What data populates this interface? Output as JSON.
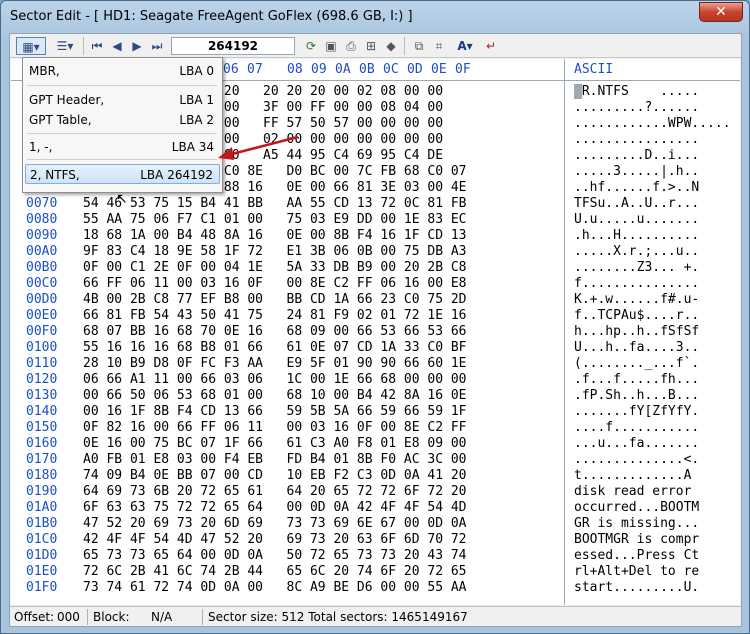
{
  "window": {
    "title": "Sector Edit - [ HD1: Seagate FreeAgent GoFlex (698.6 GB, I:) ]",
    "close_label": "✕"
  },
  "toolbar": {
    "sector_value": "264192"
  },
  "header": {
    "columns": [
      "05",
      "06",
      "07",
      "08",
      "09",
      "0A",
      "0B",
      "0C",
      "0D",
      "0E",
      "0F"
    ],
    "ascii": "ASCII"
  },
  "rows": [
    {
      "off": "",
      "hex": "            46 53 20   20 20 20 00 02 08 00 00",
      "ascii": "R.NTFS    ....."
    },
    {
      "off": "",
      "hex": "            F8 00 00   3F 00 FF 00 00 08 04 00",
      "ascii": ".........?......"
    },
    {
      "off": "",
      "hex": "            00 80 00   FF 57 50 57 00 00 00 00",
      "ascii": "............WPW....."
    },
    {
      "off": "",
      "hex": "            00 00 00   02 00 00 00 00 00 00 00",
      "ascii": "................"
    },
    {
      "off": "",
      "hex": "            00 00 00   A5 44 95 C4 69 95 C4 DE",
      "ascii": ".........D..i..."
    },
    {
      "off": "",
      "hex": "            FA 33 C0 8E   D0 BC 00 7C FB 68 C0 07",
      "ascii": ".....3.....|.h.."
    },
    {
      "off": "0060",
      "hex": "1F 1E 68 66 00 CB 88 16   0E 00 66 81 3E 03 00 4E",
      "ascii": "..hf......f.>..N"
    },
    {
      "off": "0070",
      "hex": "54 46 53 75 15 B4 41 BB   AA 55 CD 13 72 0C 81 FB",
      "ascii": "TFSu..A..U..r..."
    },
    {
      "off": "0080",
      "hex": "55 AA 75 06 F7 C1 01 00   75 03 E9 DD 00 1E 83 EC",
      "ascii": "U.u.....u......."
    },
    {
      "off": "0090",
      "hex": "18 68 1A 00 B4 48 8A 16   0E 00 8B F4 16 1F CD 13",
      "ascii": ".h...H.........."
    },
    {
      "off": "00A0",
      "hex": "9F 83 C4 18 9E 58 1F 72   E1 3B 06 0B 00 75 DB A3",
      "ascii": ".....X.r.;...u.."
    },
    {
      "off": "00B0",
      "hex": "0F 00 C1 2E 0F 00 04 1E   5A 33 DB B9 00 20 2B C8",
      "ascii": "........Z3... +."
    },
    {
      "off": "00C0",
      "hex": "66 FF 06 11 00 03 16 0F   00 8E C2 FF 06 16 00 E8",
      "ascii": "f..............."
    },
    {
      "off": "00D0",
      "hex": "4B 00 2B C8 77 EF B8 00   BB CD 1A 66 23 C0 75 2D",
      "ascii": "K.+.w......f#.u-"
    },
    {
      "off": "00E0",
      "hex": "66 81 FB 54 43 50 41 75   24 81 F9 02 01 72 1E 16",
      "ascii": "f..TCPAu$....r.."
    },
    {
      "off": "00F0",
      "hex": "68 07 BB 16 68 70 0E 16   68 09 00 66 53 66 53 66",
      "ascii": "h...hp..h..fSfSf"
    },
    {
      "off": "0100",
      "hex": "55 16 16 16 68 B8 01 66   61 0E 07 CD 1A 33 C0 BF",
      "ascii": "U...h..fa....3.."
    },
    {
      "off": "0110",
      "hex": "28 10 B9 D8 0F FC F3 AA   E9 5F 01 90 90 66 60 1E",
      "ascii": "(........_...f`."
    },
    {
      "off": "0120",
      "hex": "06 66 A1 11 00 66 03 06   1C 00 1E 66 68 00 00 00",
      "ascii": ".f...f.....fh..."
    },
    {
      "off": "0130",
      "hex": "00 66 50 06 53 68 01 00   68 10 00 B4 42 8A 16 0E",
      "ascii": ".fP.Sh..h...B..."
    },
    {
      "off": "0140",
      "hex": "00 16 1F 8B F4 CD 13 66   59 5B 5A 66 59 66 59 1F",
      "ascii": ".......fY[ZfYfY."
    },
    {
      "off": "0150",
      "hex": "0F 82 16 00 66 FF 06 11   00 03 16 0F 00 8E C2 FF",
      "ascii": "....f..........."
    },
    {
      "off": "0160",
      "hex": "0E 16 00 75 BC 07 1F 66   61 C3 A0 F8 01 E8 09 00",
      "ascii": "...u...fa......."
    },
    {
      "off": "0170",
      "hex": "A0 FB 01 E8 03 00 F4 EB   FD B4 01 8B F0 AC 3C 00",
      "ascii": "..............<."
    },
    {
      "off": "0180",
      "hex": "74 09 B4 0E BB 07 00 CD   10 EB F2 C3 0D 0A 41 20",
      "ascii": "t.............A "
    },
    {
      "off": "0190",
      "hex": "64 69 73 6B 20 72 65 61   64 20 65 72 72 6F 72 20",
      "ascii": "disk read error "
    },
    {
      "off": "01A0",
      "hex": "6F 63 63 75 72 72 65 64   00 0D 0A 42 4F 4F 54 4D",
      "ascii": "occurred...BOOTM"
    },
    {
      "off": "01B0",
      "hex": "47 52 20 69 73 20 6D 69   73 73 69 6E 67 00 0D 0A",
      "ascii": "GR is missing..."
    },
    {
      "off": "01C0",
      "hex": "42 4F 4F 54 4D 47 52 20   69 73 20 63 6F 6D 70 72",
      "ascii": "BOOTMGR is compr"
    },
    {
      "off": "01D0",
      "hex": "65 73 73 65 64 00 0D 0A   50 72 65 73 73 20 43 74",
      "ascii": "essed...Press Ct"
    },
    {
      "off": "01E0",
      "hex": "72 6C 2B 41 6C 74 2B 44   65 6C 20 74 6F 20 72 65",
      "ascii": "rl+Alt+Del to re"
    },
    {
      "off": "01F0",
      "hex": "73 74 61 72 74 0D 0A 00   8C A9 BE D6 00 00 55 AA",
      "ascii": "start.........U."
    }
  ],
  "menu": {
    "items": [
      {
        "label": "MBR,",
        "lba": "LBA 0"
      },
      {
        "label": "GPT Header,",
        "lba": "LBA 1"
      },
      {
        "label": "GPT Table,",
        "lba": "LBA 2"
      },
      {
        "label": "1, -,",
        "lba": "LBA 34"
      },
      {
        "label": "2, NTFS,",
        "lba": "LBA 264192"
      }
    ]
  },
  "status": {
    "offset_label": "Offset:",
    "offset_value": "000",
    "block_label": "Block:",
    "block_value": "N/A",
    "sector_size": "Sector size:   512 Total sectors:   1465149167"
  },
  "colors": {
    "accent": "#1c4fc2",
    "arrow": "#c0181c"
  }
}
